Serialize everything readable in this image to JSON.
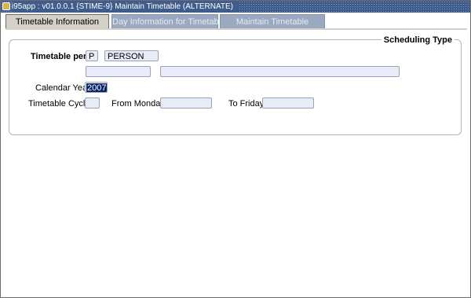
{
  "window": {
    "title": "i95app : v01.0.0.1 {STIME-9} Maintain Timetable  (ALTERNATE)"
  },
  "tabs": [
    {
      "label": "Timetable Information",
      "active": true
    },
    {
      "label": "Day Information for Timetable",
      "active": false
    },
    {
      "label": "Maintain Timetable",
      "active": false
    }
  ],
  "group": {
    "title": "Scheduling Type"
  },
  "form": {
    "timetable_per_label": "Timetable per",
    "timetable_per_code": "P",
    "timetable_per_desc": "PERSON",
    "extra_field_1": "",
    "extra_field_2": "",
    "calendar_year_label": "Calendar Year",
    "calendar_year_value": "2007",
    "timetable_cycle_label": "Timetable Cycle",
    "timetable_cycle_value": "",
    "from_monday_label": "From Monday",
    "from_monday_value": "",
    "to_friday_label": "To Friday",
    "to_friday_value": ""
  },
  "colors": {
    "titlebar": "#3f5c8c",
    "field_bg": "#e8ecf6",
    "selection": "#0a246a",
    "inactive_tab": "#9aa9bf"
  }
}
